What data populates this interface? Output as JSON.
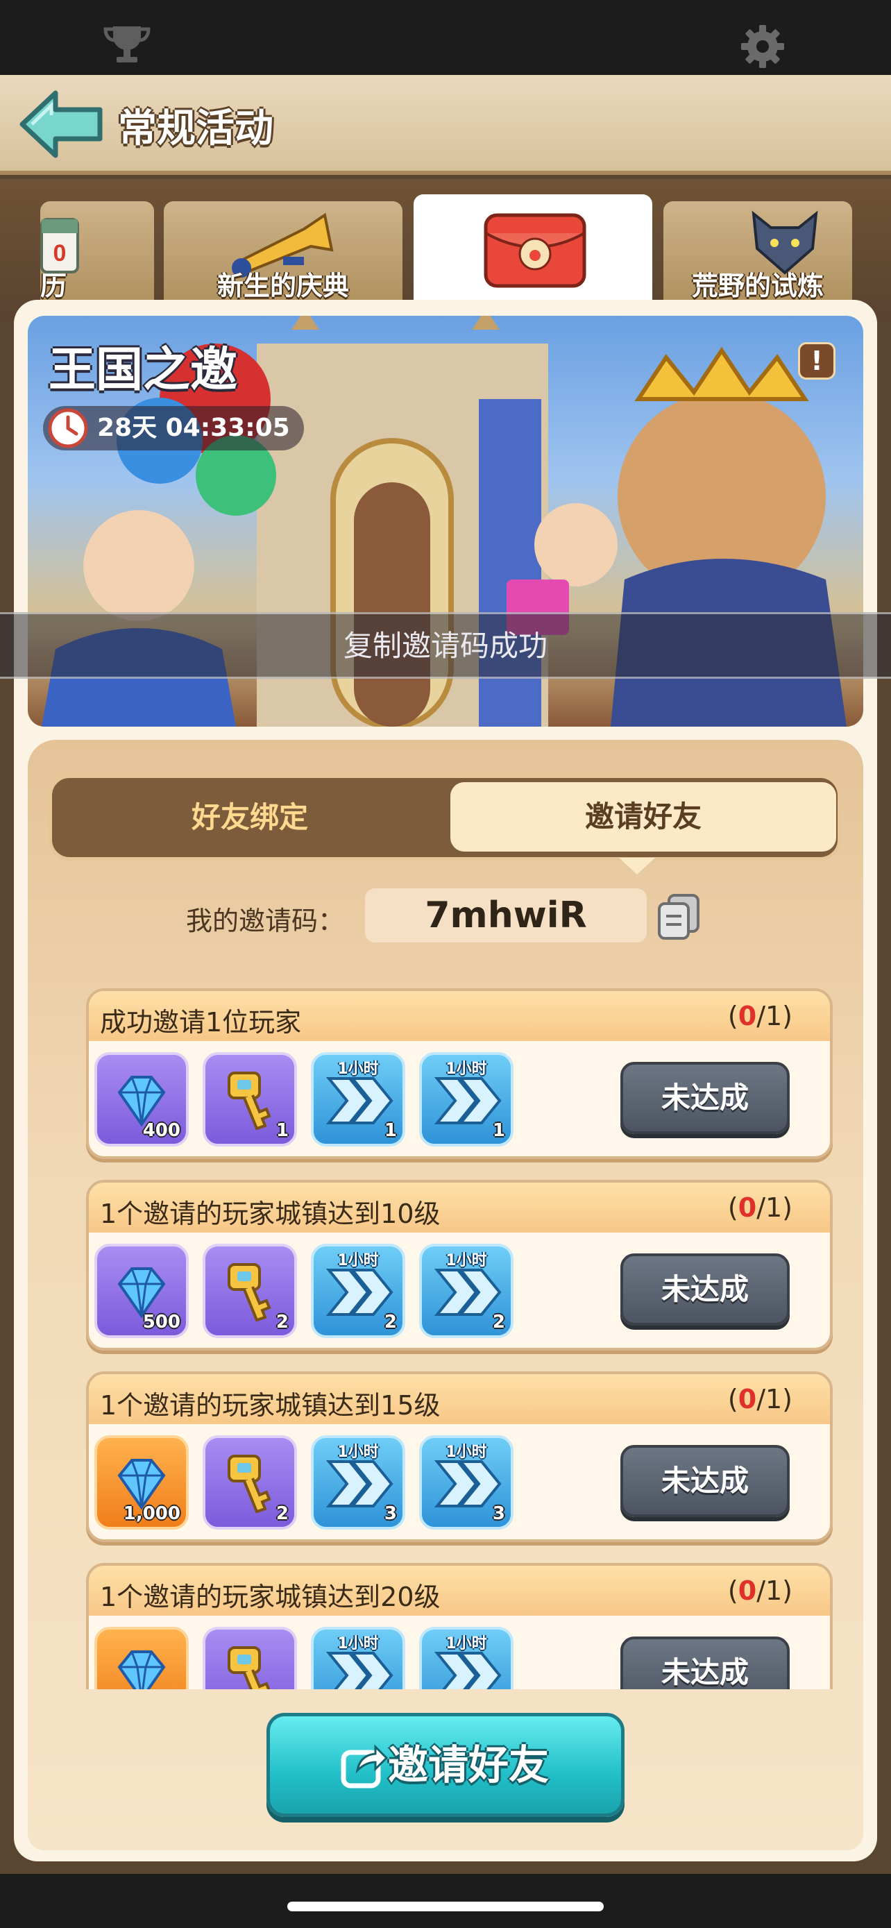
{
  "header": {
    "title": "常规活动",
    "icons": [
      "trophy-icon",
      "gear-icon",
      "back-arrow-icon"
    ]
  },
  "tabs": [
    {
      "label": "历",
      "icon": "calendar-icon"
    },
    {
      "label": "新生的庆典",
      "icon": "trumpet-icon"
    },
    {
      "label": "",
      "icon": "red-envelope-icon",
      "active": true
    },
    {
      "label": "荒野的试炼",
      "icon": "wolf-icon"
    }
  ],
  "banner": {
    "title": "王国之邀",
    "timer": "28天 04:33:05",
    "info_icon": "!"
  },
  "toast": "复制邀请码成功",
  "segments": {
    "left": "好友绑定",
    "right": "邀请好友"
  },
  "invite_code": {
    "label": "我的邀请码：",
    "value": "7mhwiR"
  },
  "tasks": [
    {
      "title": "成功邀请1位玩家",
      "progress_current": "0",
      "progress_total": "/1)",
      "progress_open": "(",
      "status": "未达成",
      "rewards": [
        {
          "type": "gem",
          "qty": "400",
          "color": "purple"
        },
        {
          "type": "key",
          "qty": "1",
          "color": "purple"
        },
        {
          "type": "speedup-hammer",
          "qty": "1",
          "hour": "1小时",
          "color": "blue"
        },
        {
          "type": "speedup-helmet",
          "qty": "1",
          "hour": "1小时",
          "color": "blue"
        }
      ]
    },
    {
      "title": "1个邀请的玩家城镇达到10级",
      "progress_current": "0",
      "progress_total": "/1)",
      "progress_open": "(",
      "status": "未达成",
      "rewards": [
        {
          "type": "gem",
          "qty": "500",
          "color": "purple"
        },
        {
          "type": "key",
          "qty": "2",
          "color": "purple"
        },
        {
          "type": "speedup",
          "qty": "2",
          "hour": "1小时",
          "color": "blue"
        },
        {
          "type": "speedup-book",
          "qty": "2",
          "hour": "1小时",
          "color": "blue"
        }
      ]
    },
    {
      "title": "1个邀请的玩家城镇达到15级",
      "progress_current": "0",
      "progress_total": "/1)",
      "progress_open": "(",
      "status": "未达成",
      "rewards": [
        {
          "type": "gem",
          "qty": "1,000",
          "color": "orange"
        },
        {
          "type": "key",
          "qty": "2",
          "color": "purple"
        },
        {
          "type": "speedup",
          "qty": "3",
          "hour": "1小时",
          "color": "blue"
        },
        {
          "type": "speedup-book",
          "qty": "3",
          "hour": "1小时",
          "color": "blue"
        }
      ]
    },
    {
      "title": "1个邀请的玩家城镇达到20级",
      "progress_current": "0",
      "progress_total": "/1)",
      "progress_open": "(",
      "status": "未达成",
      "rewards": [
        {
          "type": "gem",
          "qty": "",
          "color": "orange"
        },
        {
          "type": "key",
          "qty": "",
          "color": "purple"
        },
        {
          "type": "speedup",
          "qty": "",
          "hour": "1小时",
          "color": "blue"
        },
        {
          "type": "speedup-book",
          "qty": "",
          "hour": "1小时",
          "color": "blue"
        }
      ]
    }
  ],
  "invite_button": {
    "label": "邀请好友",
    "icon": "share-icon"
  },
  "colors": {
    "accent_teal": "#22bfc8",
    "progress_red": "#e0302a",
    "panel_tan": "#f1d9b5"
  }
}
